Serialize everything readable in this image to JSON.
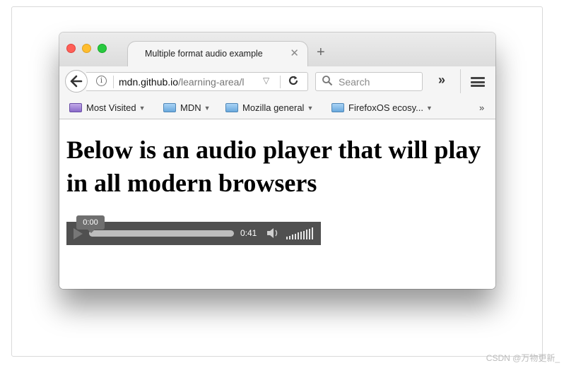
{
  "tab": {
    "title": "Multiple format audio example",
    "close_glyph": "✕",
    "new_tab_glyph": "+"
  },
  "nav": {
    "back_glyph": "➜",
    "url_host": "mdn.github.io",
    "url_path": "/learning-area/l",
    "url_dropdown_glyph": "▽",
    "reload_glyph": "C",
    "search_placeholder": "Search",
    "overflow_glyph": "»"
  },
  "bookmarks": {
    "items": [
      {
        "label": "Most Visited"
      },
      {
        "label": "MDN"
      },
      {
        "label": "Mozilla general"
      },
      {
        "label": "FirefoxOS ecosy..."
      }
    ],
    "overflow_glyph": "»"
  },
  "page": {
    "heading": "Below is an audio player that will play in all modern browsers"
  },
  "player": {
    "current_time": "0:00",
    "duration": "0:41",
    "progress_fraction": 0.0,
    "volume_fraction": 1.0
  },
  "watermark": "CSDN @万物更新_",
  "colors": {
    "close": "#ff5f57",
    "minimize": "#ffbd2e",
    "maximize": "#28c940",
    "player_bg": "#505050"
  }
}
